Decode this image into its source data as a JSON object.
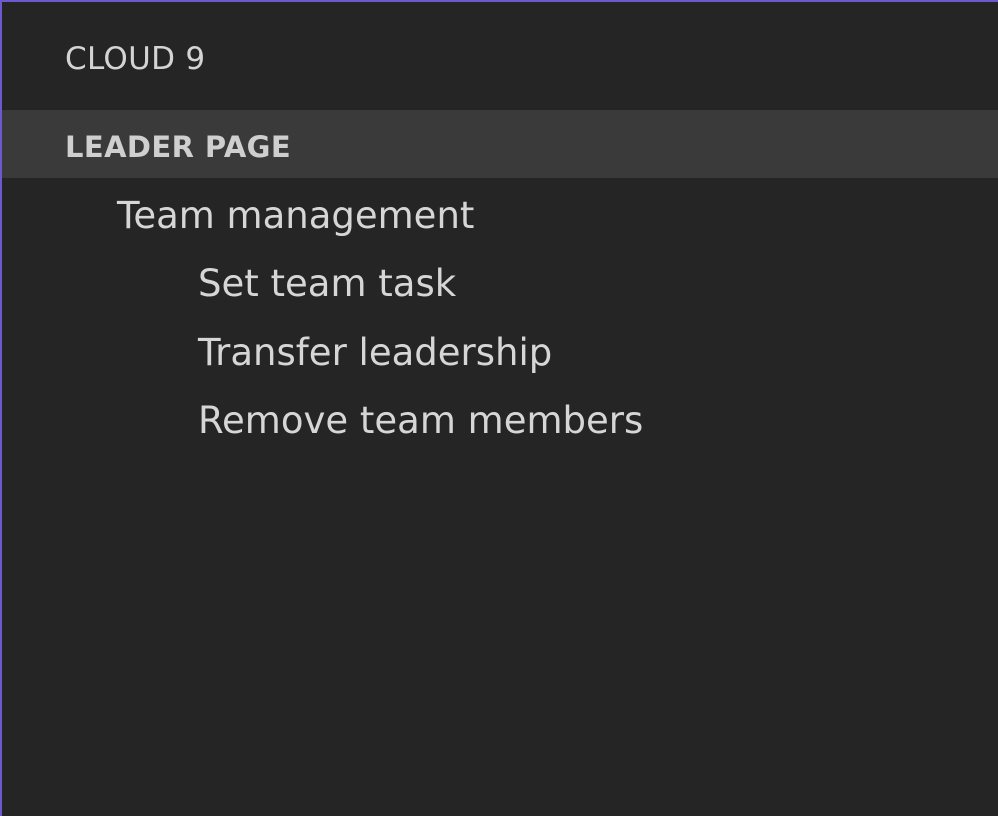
{
  "app": {
    "title": "CLOUD 9"
  },
  "section": {
    "header": "LEADER PAGE",
    "group": {
      "label": "Team management",
      "items": [
        {
          "label": "Set team task"
        },
        {
          "label": "Transfer leadership"
        },
        {
          "label": "Remove team members"
        }
      ]
    }
  },
  "colors": {
    "background": "#252525",
    "header_background": "#3a3a3a",
    "text": "#d6d6d6",
    "accent_border": "#6a5acd"
  }
}
